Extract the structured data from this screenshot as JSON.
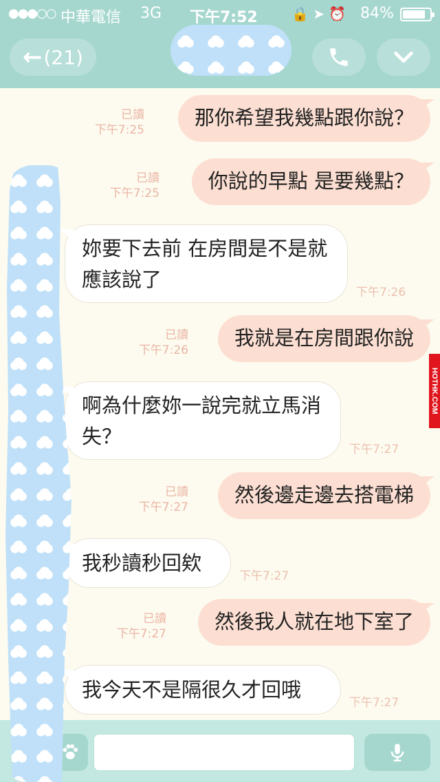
{
  "status_bar": {
    "signal": "●●●○○",
    "carrier": "中華電信",
    "network": "3G",
    "time": "下午7:52",
    "icons": "🔒 ➤ ⏰",
    "battery_percent": "84%",
    "battery_level": 0.84
  },
  "header": {
    "back_arrow": "←",
    "unread_count": "(21)"
  },
  "colors": {
    "header_bg": "#a5d7cf",
    "chat_bg": "#fdfbef",
    "outgoing_bubble": "#fcdfd2",
    "incoming_bubble": "#ffffff",
    "timestamp": "#eab5a5",
    "watermark": "#e0151e"
  },
  "messages": [
    {
      "dir": "out",
      "text": "那你希望我幾點跟你說？",
      "read": "已讀",
      "time": "下午7:25"
    },
    {
      "dir": "out",
      "text": "你說的早點 是要幾點？",
      "read": "已讀",
      "time": "下午7:25"
    },
    {
      "dir": "in",
      "text": "妳要下去前 在房間是不是就應該說了",
      "time": "下午7:26"
    },
    {
      "dir": "out",
      "text": "我就是在房間跟你說",
      "read": "已讀",
      "time": "下午7:26"
    },
    {
      "dir": "in",
      "text": "啊為什麼妳一說完就立馬消失？",
      "time": "下午7:27"
    },
    {
      "dir": "out",
      "text": "然後邊走邊去搭電梯",
      "read": "已讀",
      "time": "下午7:27"
    },
    {
      "dir": "in",
      "text": "我秒讀秒回欸",
      "time": "下午7:27"
    },
    {
      "dir": "out",
      "text": "然後我人就在地下室了",
      "read": "已讀",
      "time": "下午7:27"
    },
    {
      "dir": "in",
      "text": "我今天不是隔很久才回哦",
      "time": "下午7:27"
    }
  ],
  "watermark": "HOTHK.COM",
  "input": {
    "value": "",
    "placeholder": ""
  }
}
